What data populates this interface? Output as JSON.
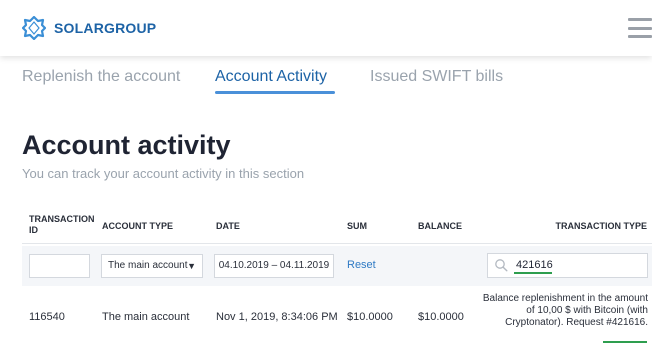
{
  "header": {
    "brand": "SOLARGROUP",
    "colors": {
      "brand": "#1d63a6",
      "accent": "#4a90d9"
    },
    "icons": {
      "logo": "solargroup-logo-icon",
      "menu": "hamburger-menu-icon"
    }
  },
  "tabs": [
    {
      "label": "Replenish the account",
      "active": false
    },
    {
      "label": "Account Activity",
      "active": true
    },
    {
      "label": "Issued SWIFT bills",
      "active": false
    }
  ],
  "page": {
    "title": "Account activity",
    "subtitle": "You can track your account activity in this section"
  },
  "table": {
    "columns": [
      "TRANSACTION ID",
      "ACCOUNT TYPE",
      "DATE",
      "SUM",
      "BALANCE",
      "TRANSACTION TYPE"
    ],
    "filters": {
      "transaction_id": "",
      "account_type": "The main account",
      "date_range": "04.10.2019 – 04.11.2019",
      "reset_label": "Reset",
      "search_value": "421616",
      "search_icon": "search-icon"
    },
    "rows": [
      {
        "id": "116540",
        "account_type": "The main account",
        "date": "Nov 1, 2019, 8:34:06 PM",
        "sum": "$10.0000",
        "balance": "$10.0000",
        "type": "Balance replenishment in the amount of 10,00 $ with Bitcoin (with Cryptonator). Request #421616."
      }
    ]
  }
}
